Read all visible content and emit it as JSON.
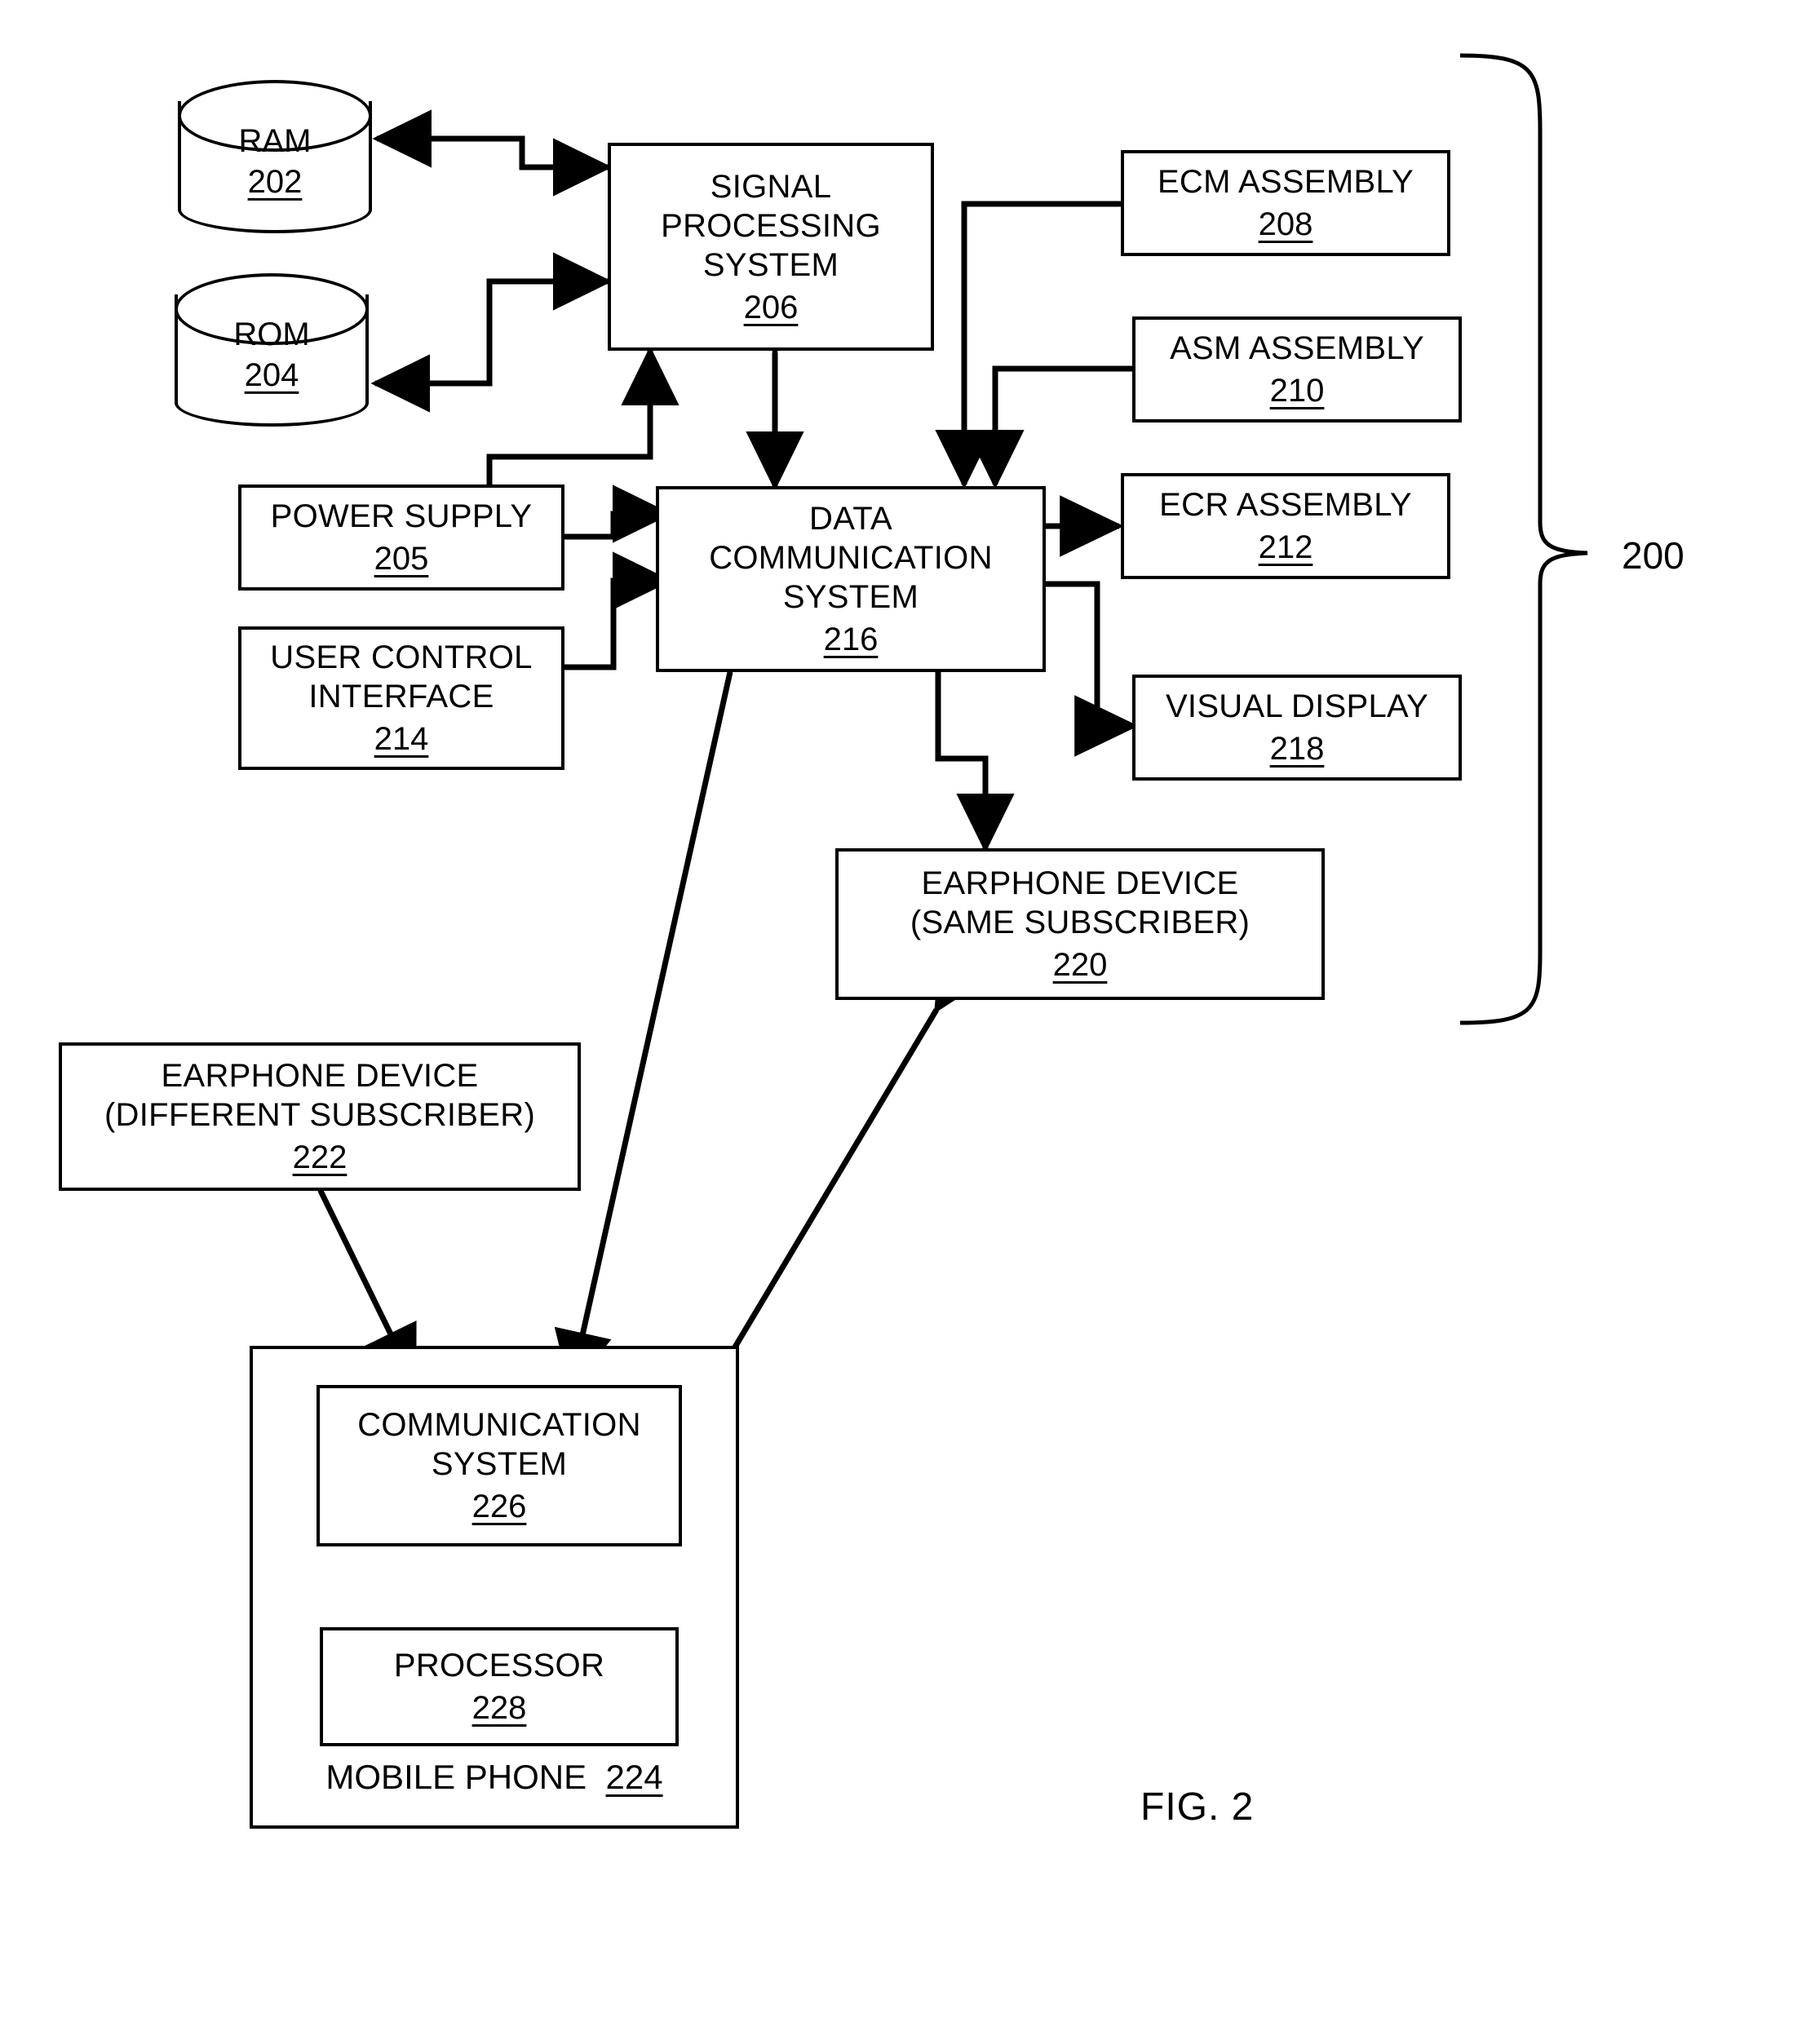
{
  "figure": {
    "caption": "FIG. 2",
    "system_reference": "200"
  },
  "nodes": {
    "ram": {
      "title": "RAM",
      "number": "202"
    },
    "rom": {
      "title": "ROM",
      "number": "204"
    },
    "power_supply": {
      "title": "POWER SUPPLY",
      "number": "205"
    },
    "signal_proc": {
      "title": "SIGNAL\nPROCESSING\nSYSTEM",
      "number": "206"
    },
    "ecm": {
      "title": "ECM ASSEMBLY",
      "number": "208"
    },
    "asm": {
      "title": "ASM ASSEMBLY",
      "number": "210"
    },
    "ecr": {
      "title": "ECR ASSEMBLY",
      "number": "212"
    },
    "user_control": {
      "title": "USER CONTROL\nINTERFACE",
      "number": "214"
    },
    "data_comm": {
      "title": "DATA\nCOMMUNICATION\nSYSTEM",
      "number": "216"
    },
    "visual_display": {
      "title": "VISUAL DISPLAY",
      "number": "218"
    },
    "earphone_same": {
      "title": "EARPHONE DEVICE\n(SAME SUBSCRIBER)",
      "number": "220"
    },
    "earphone_diff": {
      "title": "EARPHONE DEVICE\n(DIFFERENT SUBSCRIBER)",
      "number": "222"
    },
    "mobile_phone": {
      "title": "MOBILE PHONE",
      "number": "224"
    },
    "comm_system": {
      "title": "COMMUNICATION\nSYSTEM",
      "number": "226"
    },
    "processor": {
      "title": "PROCESSOR",
      "number": "228"
    }
  },
  "chart_data": {
    "type": "diagram",
    "title": "FIG. 2 — Earphone system block diagram",
    "blocks": [
      {
        "id": "202",
        "label": "RAM",
        "shape": "cylinder"
      },
      {
        "id": "204",
        "label": "ROM",
        "shape": "cylinder"
      },
      {
        "id": "205",
        "label": "POWER SUPPLY",
        "shape": "rect"
      },
      {
        "id": "206",
        "label": "SIGNAL PROCESSING SYSTEM",
        "shape": "rect"
      },
      {
        "id": "208",
        "label": "ECM ASSEMBLY",
        "shape": "rect"
      },
      {
        "id": "210",
        "label": "ASM ASSEMBLY",
        "shape": "rect"
      },
      {
        "id": "212",
        "label": "ECR ASSEMBLY",
        "shape": "rect"
      },
      {
        "id": "214",
        "label": "USER CONTROL INTERFACE",
        "shape": "rect"
      },
      {
        "id": "216",
        "label": "DATA COMMUNICATION SYSTEM",
        "shape": "rect"
      },
      {
        "id": "218",
        "label": "VISUAL DISPLAY",
        "shape": "rect"
      },
      {
        "id": "220",
        "label": "EARPHONE DEVICE (SAME SUBSCRIBER)",
        "shape": "rect"
      },
      {
        "id": "222",
        "label": "EARPHONE DEVICE (DIFFERENT SUBSCRIBER)",
        "shape": "rect"
      },
      {
        "id": "224",
        "label": "MOBILE PHONE",
        "shape": "container"
      },
      {
        "id": "226",
        "label": "COMMUNICATION SYSTEM",
        "shape": "rect"
      },
      {
        "id": "228",
        "label": "PROCESSOR",
        "shape": "rect"
      }
    ],
    "edges": [
      {
        "from": "206",
        "to": "202",
        "arrow": "single"
      },
      {
        "from": "202",
        "to": "206",
        "arrow": "single"
      },
      {
        "from": "206",
        "to": "204",
        "arrow": "single"
      },
      {
        "from": "204",
        "to": "206",
        "arrow": "single"
      },
      {
        "from": "205",
        "to": "206",
        "arrow": "single"
      },
      {
        "from": "205",
        "to": "216",
        "arrow": "single"
      },
      {
        "from": "214",
        "to": "216",
        "arrow": "single"
      },
      {
        "from": "206",
        "to": "216",
        "arrow": "double"
      },
      {
        "from": "208",
        "to": "216",
        "arrow": "single"
      },
      {
        "from": "210",
        "to": "216",
        "arrow": "single"
      },
      {
        "from": "216",
        "to": "212",
        "arrow": "single"
      },
      {
        "from": "216",
        "to": "218",
        "arrow": "single"
      },
      {
        "from": "216",
        "to": "220",
        "arrow": "double"
      },
      {
        "from": "216",
        "to": "226",
        "arrow": "double"
      },
      {
        "from": "220",
        "to": "226",
        "arrow": "double"
      },
      {
        "from": "222",
        "to": "226",
        "arrow": "double"
      }
    ],
    "bracket_label": "200"
  }
}
